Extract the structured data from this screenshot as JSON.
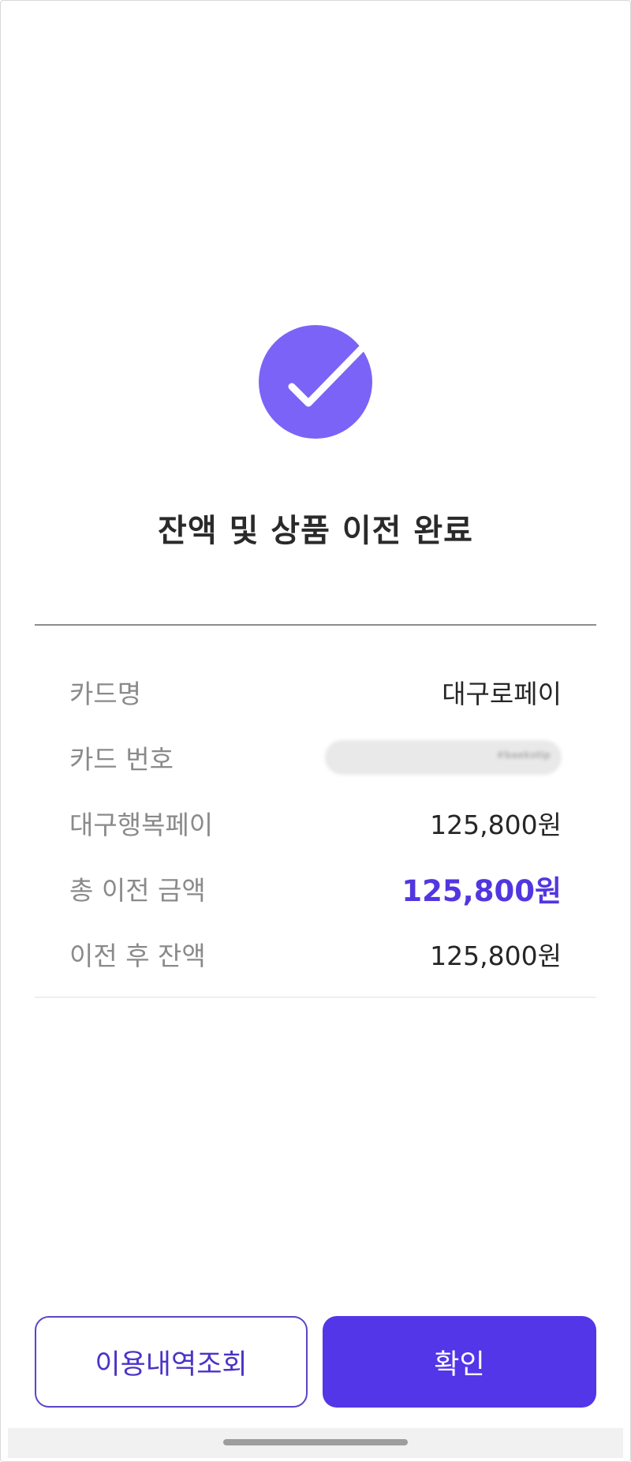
{
  "title": "잔액 및 상품 이전 완료",
  "status_icon": "check-icon",
  "accent_color": "#5236e8",
  "badge_color": "#7b63f7",
  "details": [
    {
      "label": "카드명",
      "value": "대구로페이"
    },
    {
      "label": "카드 번호",
      "value": "#baekstip"
    },
    {
      "label": "대구행복페이",
      "value": "125,800원"
    },
    {
      "label": "총 이전 금액",
      "value": "125,800원"
    },
    {
      "label": "이전 후 잔액",
      "value": "125,800원"
    }
  ],
  "buttons": {
    "history": "이용내역조회",
    "confirm": "확인"
  }
}
